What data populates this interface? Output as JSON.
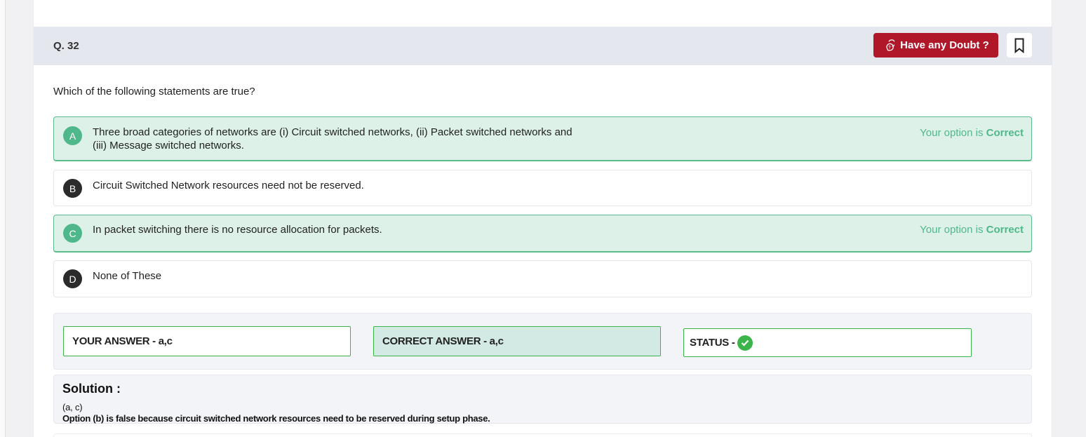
{
  "question": {
    "number": "Q. 32",
    "text": "Which of the following statements are true?"
  },
  "header": {
    "doubt_label": "Have any Doubt ?",
    "doubt_icon": "chat-question-icon",
    "bookmark_icon": "bookmark-icon"
  },
  "options": [
    {
      "letter": "A",
      "line1": "Three broad categories of networks are (i) Circuit switched networks, (ii) Packet switched networks and",
      "line2": "(iii) Message switched networks.",
      "selected_correct": true,
      "status_prefix": "Your option is ",
      "status_word": "Correct"
    },
    {
      "letter": "B",
      "line1": "Circuit Switched Network resources need not be reserved.",
      "selected_correct": false
    },
    {
      "letter": "C",
      "line1": "In packet switching there is no resource allocation for packets.",
      "selected_correct": true,
      "status_prefix": "Your option is ",
      "status_word": "Correct"
    },
    {
      "letter": "D",
      "line1": "None of These",
      "selected_correct": false
    }
  ],
  "answers": {
    "your_answer": "YOUR ANSWER - a,c",
    "correct_answer": "CORRECT ANSWER - a,c",
    "status_label": "STATUS -",
    "status_icon": "check-circle-icon"
  },
  "solution": {
    "title": "Solution :",
    "line1": "(a, c)",
    "line2": "Option (b) is false because circuit switched network resources need to be reserved during setup phase."
  },
  "colors": {
    "header_bg": "#e5e7ef",
    "doubt_button": "#b0182a",
    "correct_bg": "#ddf1e8",
    "correct_accent": "#4fb88b",
    "status_green": "#3bb54a"
  }
}
